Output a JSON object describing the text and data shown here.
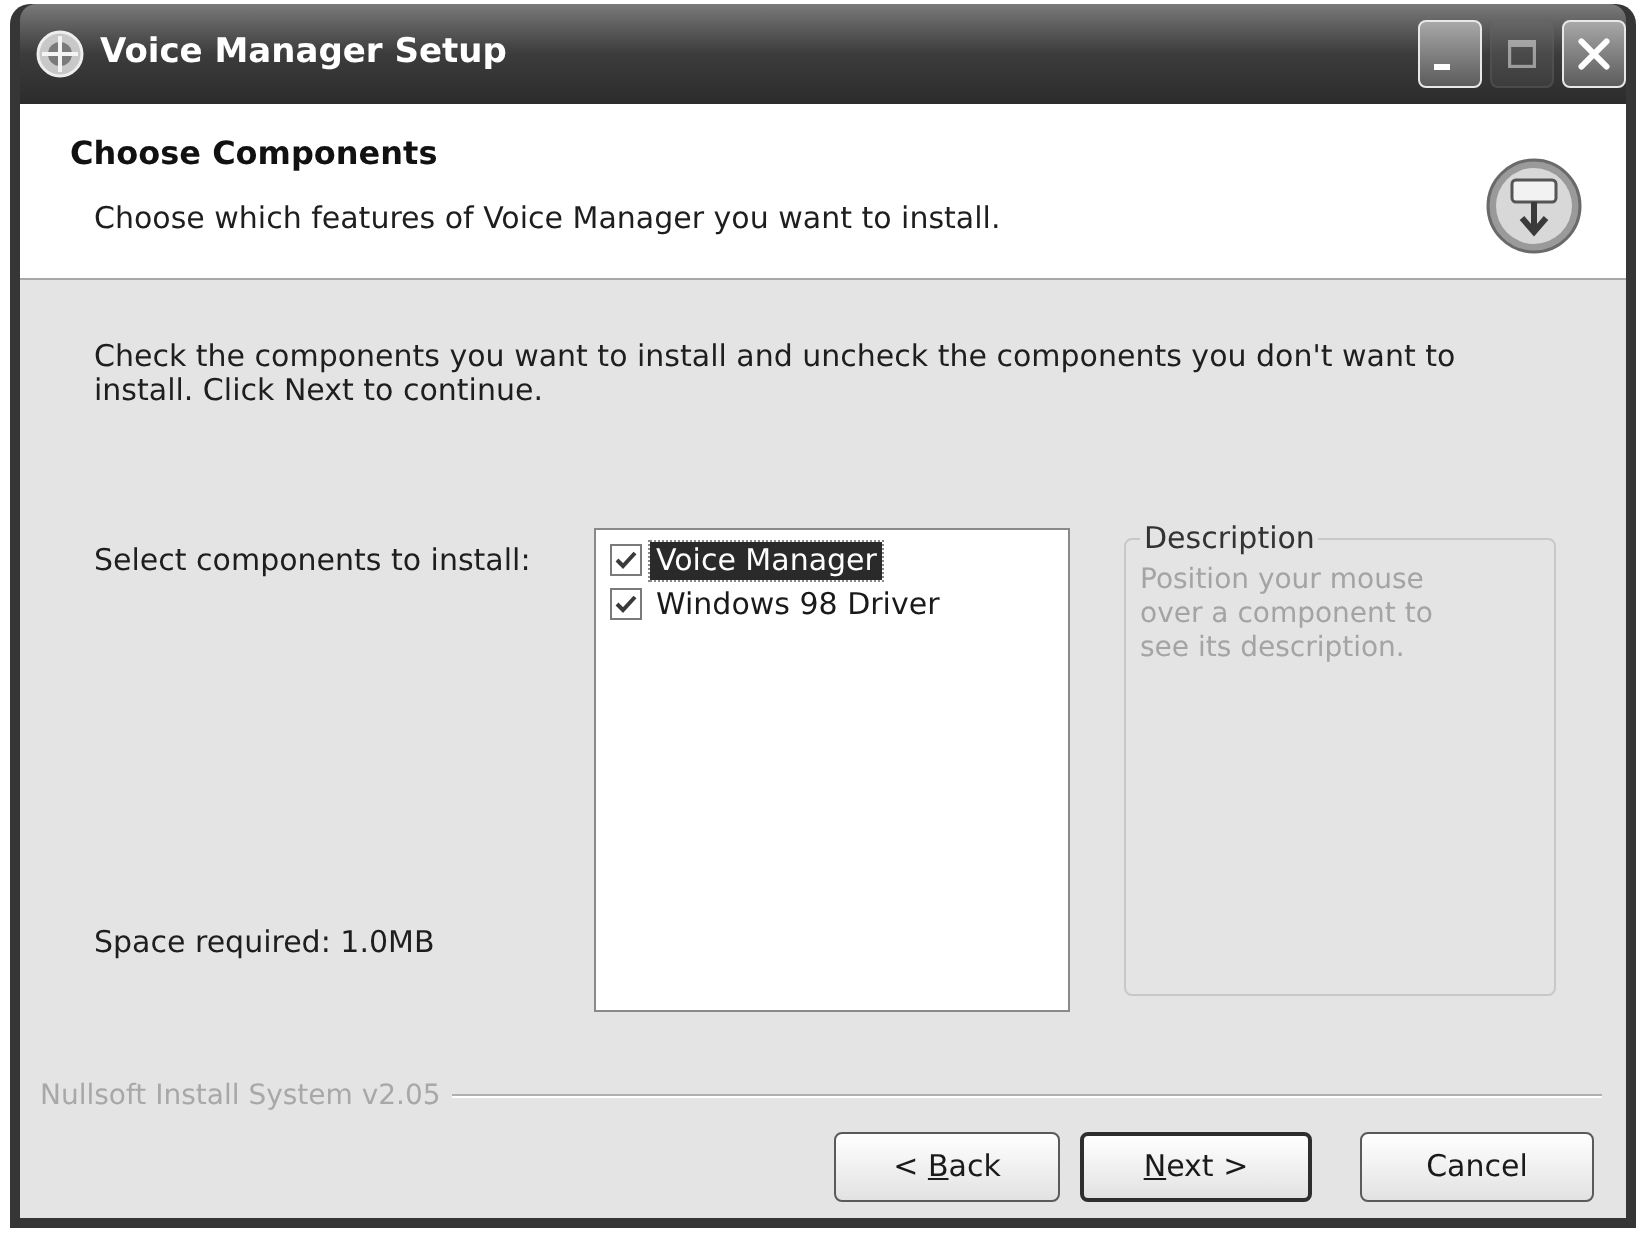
{
  "window": {
    "title": "Voice Manager Setup",
    "controls": [
      {
        "kind": "minimize",
        "disabled": false
      },
      {
        "kind": "maximize",
        "disabled": true
      },
      {
        "kind": "close",
        "disabled": false
      }
    ]
  },
  "header": {
    "title": "Choose Components",
    "subtitle": "Choose which features of Voice Manager you want to install."
  },
  "instructions": "Check the components you want to install and uncheck the components you don't want to install. Click Next to continue.",
  "select_label": "Select components to install:",
  "components": [
    {
      "label": "Voice Manager",
      "checked": true,
      "selected": true
    },
    {
      "label": "Windows 98 Driver",
      "checked": true,
      "selected": false
    }
  ],
  "description": {
    "title": "Description",
    "text": "Position your mouse over a component to see its description.",
    "disabled": true
  },
  "space_required": "Space required: 1.0MB",
  "branding": "Nullsoft Install System v2.05",
  "buttons": [
    {
      "kind": "back",
      "default": false,
      "label": [
        {
          "text": "< ",
          "underline": false
        },
        {
          "text": "B",
          "underline": true
        },
        {
          "text": "ack",
          "underline": false
        }
      ]
    },
    {
      "kind": "next",
      "default": true,
      "label": [
        {
          "text": "N",
          "underline": true
        },
        {
          "text": "ext >",
          "underline": false
        }
      ]
    },
    {
      "kind": "cancel",
      "default": false,
      "label": [
        {
          "text": "Cancel",
          "underline": false
        }
      ]
    }
  ]
}
